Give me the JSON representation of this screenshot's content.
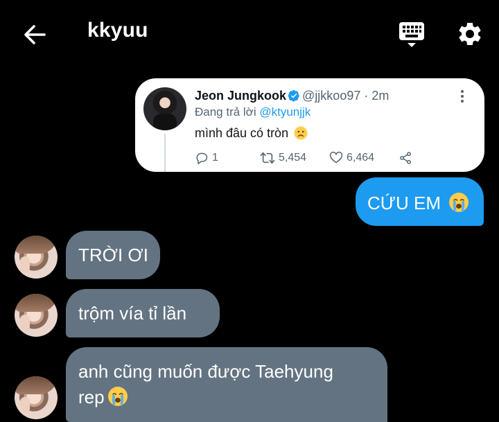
{
  "header": {
    "title": "kkyuu",
    "icons": [
      "arrow-left-icon",
      "keyboard-icon",
      "gear-icon"
    ]
  },
  "tweet": {
    "name": "Jeon Jungkook",
    "handle": "@jjkkoo97",
    "separator": " · ",
    "time": "2m",
    "reply_prefix": "Đang trả lời ",
    "reply_mention": "@ktyunjjk",
    "text": "mình đâu có tròn",
    "text_emoji": "slightly-frowning-face",
    "replies": "1",
    "retweets": "5,454",
    "likes": "6,464",
    "colors": {
      "name": "#0f1419",
      "meta": "#536471",
      "mention": "#1d9bf0",
      "verified": "#1d9bf0"
    }
  },
  "messages": [
    {
      "from": "me",
      "text": "CỨU EM",
      "emoji": "crying-face"
    },
    {
      "from": "them",
      "text": "TRỜI ƠI"
    },
    {
      "from": "them",
      "text": "trộm vía tỉ lần"
    },
    {
      "from": "them",
      "lines": [
        "anh cũng muốn được Taehyung",
        "rep"
      ],
      "emoji": "crying-face"
    }
  ],
  "colors": {
    "background": "#000000",
    "sent_bubble": "#1d9bf0",
    "received_bubble": "#637381",
    "tweet_card": "#ffffff"
  }
}
